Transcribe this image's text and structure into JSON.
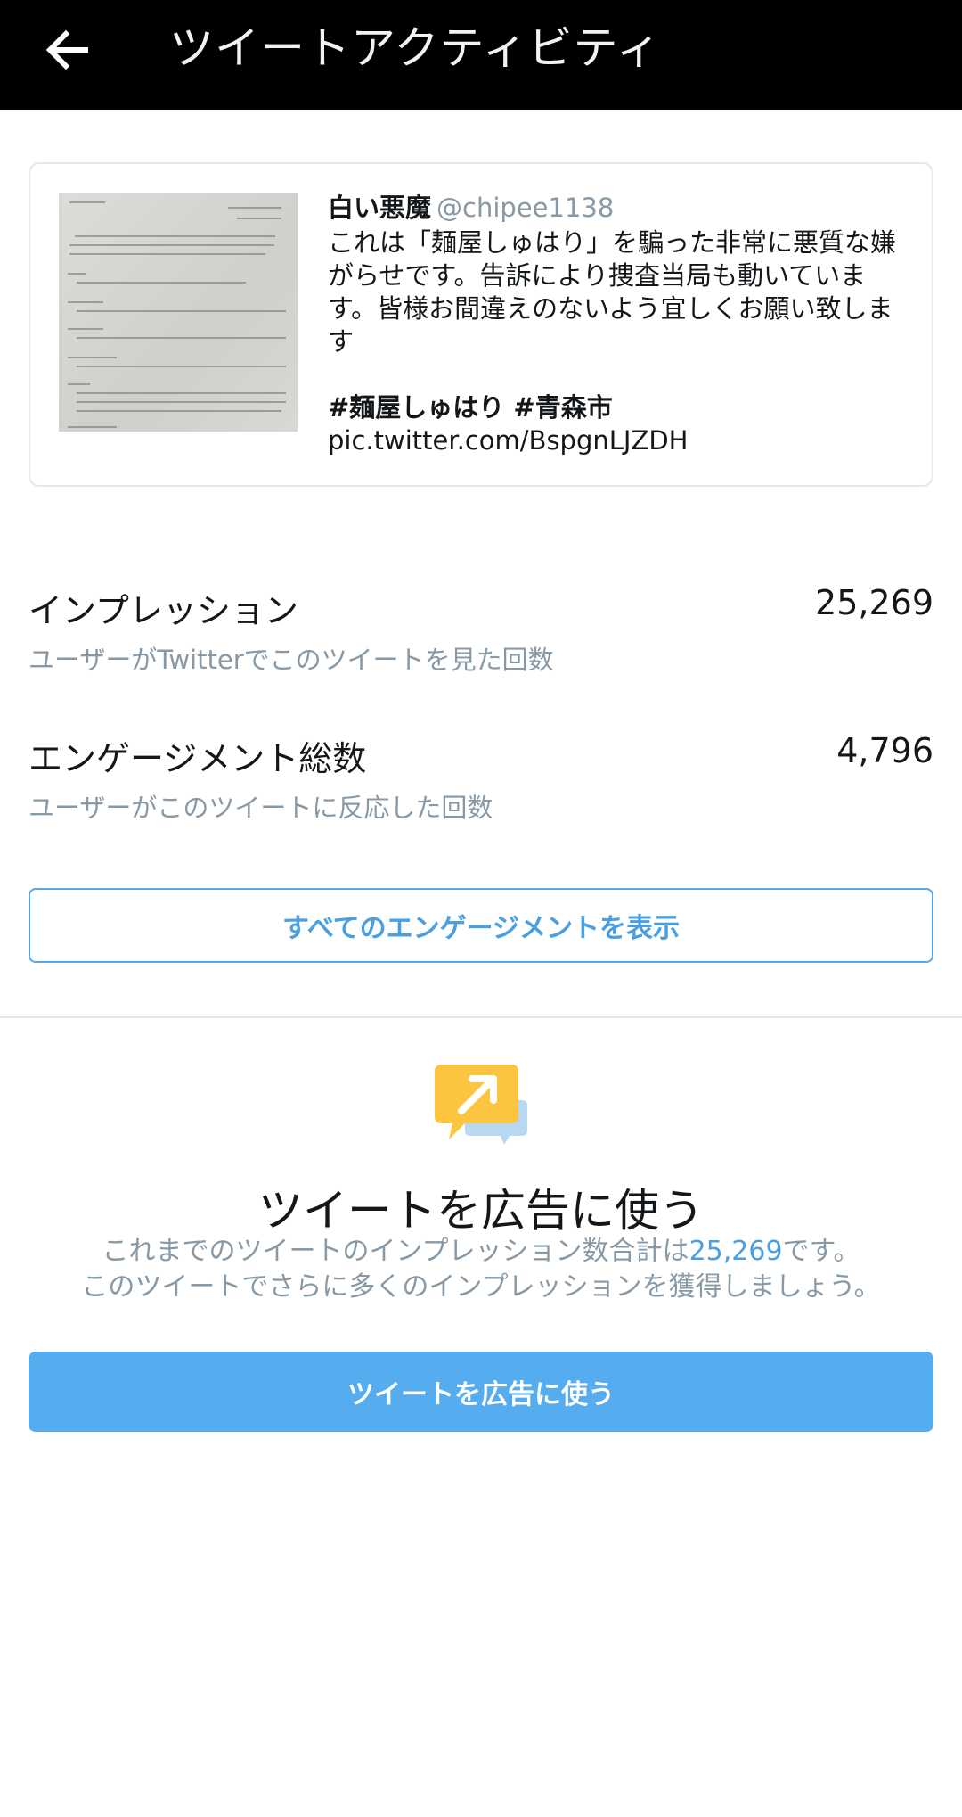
{
  "header": {
    "title": "ツイートアクティビティ"
  },
  "tweet": {
    "author_name": "白い悪魔",
    "author_handle": "@chipee1138",
    "text": "これは「麺屋しゅはり」を騙った非常に悪質な嫌がらせです。告訴により捜査当局も動いています。皆様お間違えのないよう宜しくお願い致します",
    "hashtags": "#麺屋しゅはり #青森市",
    "link": "pic.twitter.com/BspgnLJZDH"
  },
  "metrics": [
    {
      "label": "インプレッション",
      "description": "ユーザーがTwitterでこのツイートを見た回数",
      "value": "25,269"
    },
    {
      "label": "エンゲージメント総数",
      "description": "ユーザーがこのツイートに反応した回数",
      "value": "4,796"
    }
  ],
  "view_engagements_button": "すべてのエンゲージメントを表示",
  "promo": {
    "title": "ツイートを広告に使う",
    "desc_line1_prefix": "これまでのツイートのインプレッション数合計は",
    "desc_line1_value": "25,269",
    "desc_line1_suffix": "です。",
    "desc_line2": "このツイートでさらに多くのインプレッションを獲得しましょう。",
    "button": "ツイートを広告に使う"
  },
  "colors": {
    "accent": "#55acee",
    "header_bg": "#000000",
    "muted_text": "#8899a6",
    "promo_icon": "#fcc540"
  }
}
